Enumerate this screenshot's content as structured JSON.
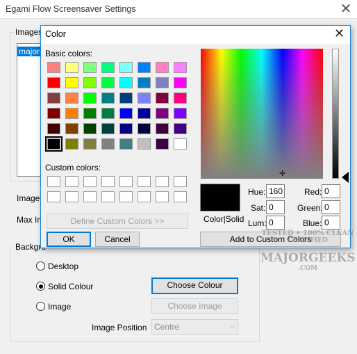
{
  "main": {
    "title": "Egami Flow Screensaver Settings",
    "images_group_label": "Images",
    "images_list_selected": "majorg",
    "image_label": "Image",
    "max_label": "Max Im",
    "background_group_label": "Backgro",
    "radio_desktop": "Desktop",
    "radio_solid": "Solid Colour",
    "radio_image": "Image",
    "selected_background": "Solid Colour",
    "choose_colour_button": "Choose Colour",
    "choose_image_button": "Choose Image",
    "image_position_label": "Image Position",
    "image_position_value": "Centre"
  },
  "dialog": {
    "title": "Color",
    "basic_colors_label": "Basic colors:",
    "custom_colors_label": "Custom colors:",
    "define_custom_button": "Define Custom Colors >>",
    "ok_button": "OK",
    "cancel_button": "Cancel",
    "color_solid_label": "Color|Solid",
    "hue_label": "Hue:",
    "hue_value": "160",
    "sat_label": "Sat:",
    "sat_value": "0",
    "lum_label": "Lum:",
    "lum_value": "0",
    "red_label": "Red:",
    "red_value": "0",
    "green_label": "Green:",
    "green_value": "0",
    "blue_label": "Blue:",
    "blue_value": "0",
    "add_custom_button": "Add to Custom Colors",
    "current_color": "#000000",
    "basic_colors": [
      [
        "#ff8080",
        "#ffff80",
        "#80ff80",
        "#00ff80",
        "#80ffff",
        "#0080ff",
        "#ff80c0",
        "#ff80ff"
      ],
      [
        "#ff0000",
        "#ffff00",
        "#80ff00",
        "#00ff40",
        "#00ffff",
        "#0080c0",
        "#8080c0",
        "#ff00ff"
      ],
      [
        "#804040",
        "#ff8040",
        "#00ff00",
        "#008080",
        "#004080",
        "#8080ff",
        "#800040",
        "#ff0080"
      ],
      [
        "#800000",
        "#ff8000",
        "#008000",
        "#008040",
        "#0000ff",
        "#0000a0",
        "#800080",
        "#8000ff"
      ],
      [
        "#400000",
        "#804000",
        "#004000",
        "#004040",
        "#000080",
        "#000040",
        "#400040",
        "#400080"
      ],
      [
        "#000000",
        "#808000",
        "#808040",
        "#808080",
        "#408080",
        "#c0c0c0",
        "#400040",
        "#ffffff"
      ]
    ]
  },
  "watermark": {
    "line1": "TESTED • 100% CLEAN",
    "line2": "CERTIFIED",
    "line3": "MAJORGEEKS",
    "line4": ".COM"
  }
}
